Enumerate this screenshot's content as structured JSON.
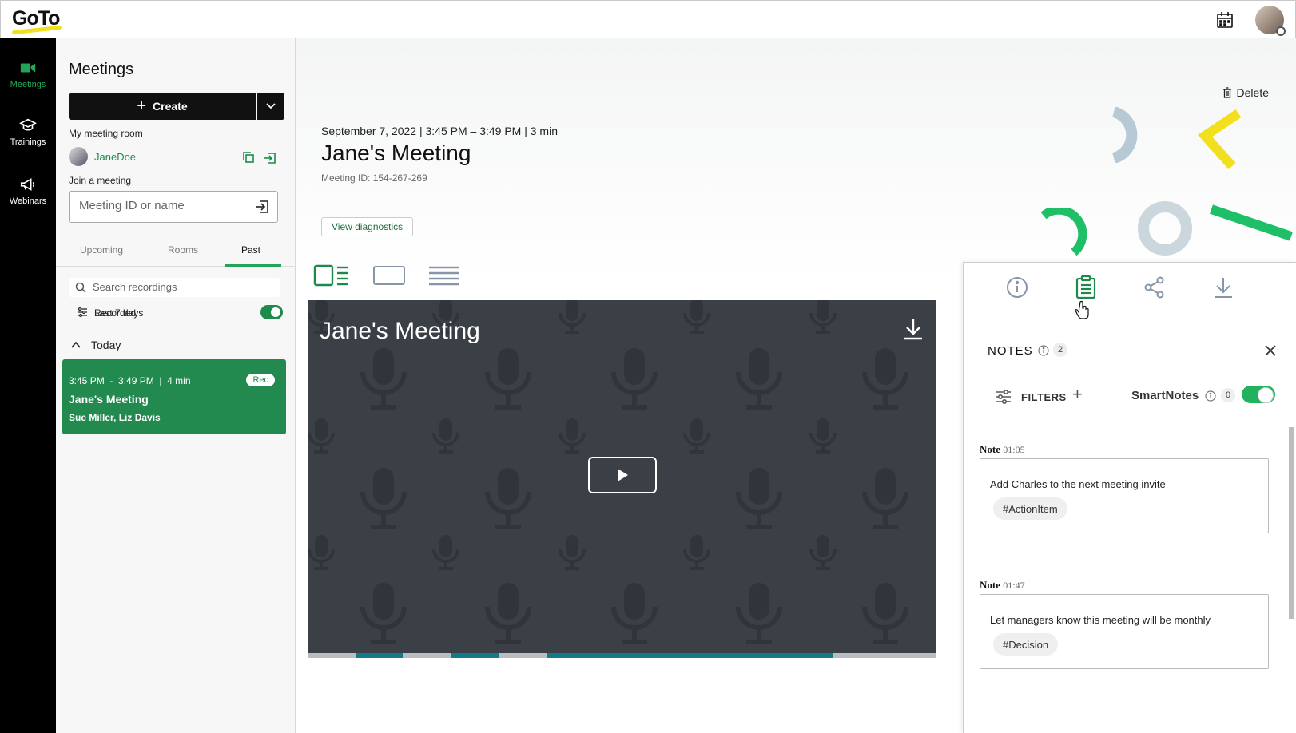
{
  "app": {
    "logo": "GoTo"
  },
  "rail": {
    "items": [
      {
        "label": "Meetings",
        "icon": "video-camera-icon",
        "active": true
      },
      {
        "label": "Trainings",
        "icon": "graduation-cap-icon",
        "active": false
      },
      {
        "label": "Webinars",
        "icon": "megaphone-icon",
        "active": false
      }
    ]
  },
  "panel": {
    "title": "Meetings",
    "create_label": "Create",
    "my_room_label": "My meeting room",
    "room_name": "JaneDoe",
    "join_label": "Join a meeting",
    "join_placeholder": "Meeting ID or name",
    "tabs": [
      {
        "label": "Upcoming",
        "active": false
      },
      {
        "label": "Rooms",
        "active": false
      },
      {
        "label": "Past",
        "active": true
      }
    ],
    "search_placeholder": "Search recordings",
    "filter_label": "Last 7 days",
    "recorded_label": "Recorded",
    "recorded_on": true,
    "group_label": "Today",
    "recording": {
      "time": "3:45 PM  -  3:49 PM  |  4 min",
      "badge": "Rec",
      "title": "Jane's Meeting",
      "people": "Sue Miller, Liz Davis"
    }
  },
  "main": {
    "delete_label": "Delete",
    "meta": "September 7, 2022 | 3:45 PM – 3:49 PM | 3 min",
    "title": "Jane's Meeting",
    "meeting_id": "Meeting ID: 154-267-269",
    "diagnostics_label": "View diagnostics",
    "video_title": "Jane's Meeting",
    "accent": "#22a55a"
  },
  "notes": {
    "title": "NOTES",
    "count": "2",
    "filters_label": "FILTERS",
    "smartnotes_label": "SmartNotes",
    "smartnotes_count": "0",
    "smartnotes_on": true,
    "items": [
      {
        "label": "Note",
        "time": "01:05",
        "text": "Add Charles to the next meeting invite",
        "tag": "#ActionItem"
      },
      {
        "label": "Note",
        "time": "01:47",
        "text": "Let managers know this meeting will be monthly",
        "tag": "#Decision"
      }
    ]
  }
}
